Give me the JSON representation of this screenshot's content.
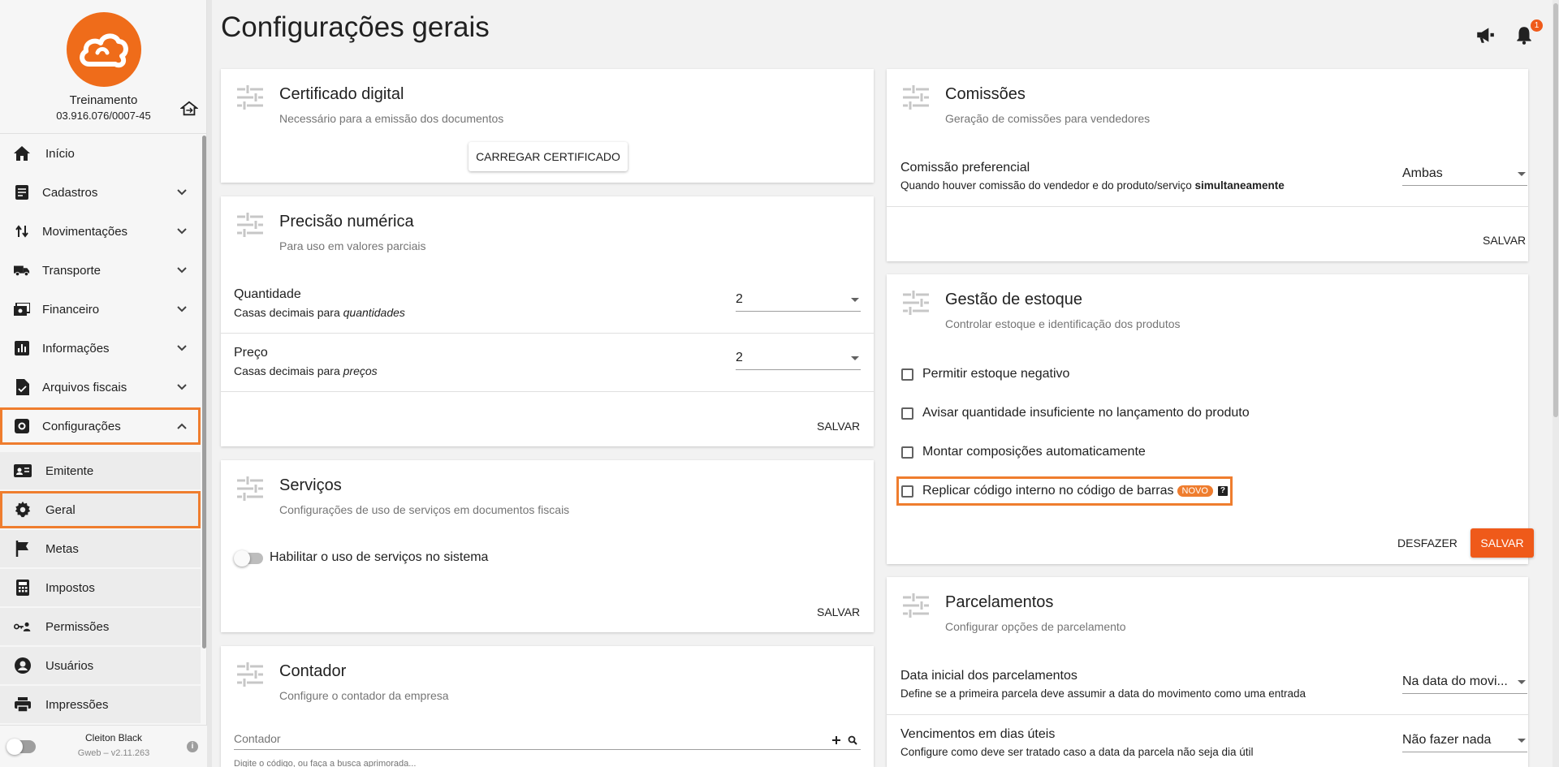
{
  "sidebar": {
    "company_name": "Treinamento",
    "company_cnpj": "03.916.076/0007-45",
    "menu": [
      {
        "label": "Início",
        "icon": "home-icon",
        "expandable": false
      },
      {
        "label": "Cadastros",
        "icon": "document-icon",
        "expandable": true
      },
      {
        "label": "Movimentações",
        "icon": "swap-icon",
        "expandable": true
      },
      {
        "label": "Transporte",
        "icon": "truck-icon",
        "expandable": true
      },
      {
        "label": "Financeiro",
        "icon": "money-icon",
        "expandable": true
      },
      {
        "label": "Informações",
        "icon": "bar-chart-icon",
        "expandable": true
      },
      {
        "label": "Arquivos fiscais",
        "icon": "file-icon",
        "expandable": true
      },
      {
        "label": "Configurações",
        "icon": "settings-box-icon",
        "expandable": true,
        "expanded": true
      }
    ],
    "submenu": [
      {
        "label": "Emitente",
        "icon": "id-card-icon"
      },
      {
        "label": "Geral",
        "icon": "gear-icon",
        "selected": true
      },
      {
        "label": "Metas",
        "icon": "flag-icon"
      },
      {
        "label": "Impostos",
        "icon": "calculator-icon"
      },
      {
        "label": "Permissões",
        "icon": "key-icon"
      },
      {
        "label": "Usuários",
        "icon": "user-icon"
      },
      {
        "label": "Impressões",
        "icon": "printer-icon"
      }
    ],
    "footer": {
      "user_name": "Cleiton Black",
      "version": "Gweb – v2.11.263"
    }
  },
  "header": {
    "title": "Configurações gerais",
    "notification_count": "1"
  },
  "cards": {
    "certificado": {
      "title": "Certificado digital",
      "subtitle": "Necessário para a emissão dos documentos",
      "button": "CARREGAR CERTIFICADO"
    },
    "precisao": {
      "title": "Precisão numérica",
      "subtitle": "Para uso em valores parciais",
      "quantidade_title": "Quantidade",
      "quantidade_desc_pre": "Casas decimais para ",
      "quantidade_desc_em": "quantidades",
      "quantidade_value": "2",
      "preco_title": "Preço",
      "preco_desc_pre": "Casas decimais para ",
      "preco_desc_em": "preços",
      "preco_value": "2",
      "save": "SALVAR"
    },
    "servicos": {
      "title": "Serviços",
      "subtitle": "Configurações de uso de serviços em documentos fiscais",
      "switch_label": "Habilitar o uso de serviços no sistema",
      "switch_on": false,
      "save": "SALVAR"
    },
    "contador": {
      "title": "Contador",
      "subtitle": "Configure o contador da empresa",
      "input_label": "Contador",
      "hint": "Digite o código, ou faça a busca aprimorada..."
    },
    "comissoes": {
      "title": "Comissões",
      "subtitle": "Geração de comissões para vendedores",
      "field_title": "Comissão preferencial",
      "field_desc_pre": "Quando houver comissão do vendedor e do produto/serviço ",
      "field_desc_bold": "simultaneamente",
      "value": "Ambas",
      "save": "SALVAR"
    },
    "estoque": {
      "title": "Gestão de estoque",
      "subtitle": "Controlar estoque e identificação dos produtos",
      "options": [
        {
          "label": "Permitir estoque negativo",
          "checked": false
        },
        {
          "label": "Avisar quantidade insuficiente no lançamento do produto",
          "checked": false
        },
        {
          "label": "Montar composições automaticamente",
          "checked": false
        },
        {
          "label": "Replicar código interno no código de barras",
          "checked": false,
          "badge": "NOVO"
        }
      ],
      "undo": "DESFAZER",
      "save": "SALVAR"
    },
    "parcelamentos": {
      "title": "Parcelamentos",
      "subtitle": "Configurar opções de parcelamento",
      "field1_title": "Data inicial dos parcelamentos",
      "field1_desc": "Define se a primeira parcela deve assumir a data do movimento como uma entrada",
      "field1_value": "Na data do movi...",
      "field2_title": "Vencimentos em dias úteis",
      "field2_desc": "Configure como deve ser tratado caso a data da parcela não seja dia útil",
      "field2_value": "Não fazer nada"
    }
  },
  "colors": {
    "accent": "#ef5a1a",
    "highlight_outline": "#ef7d2e"
  }
}
